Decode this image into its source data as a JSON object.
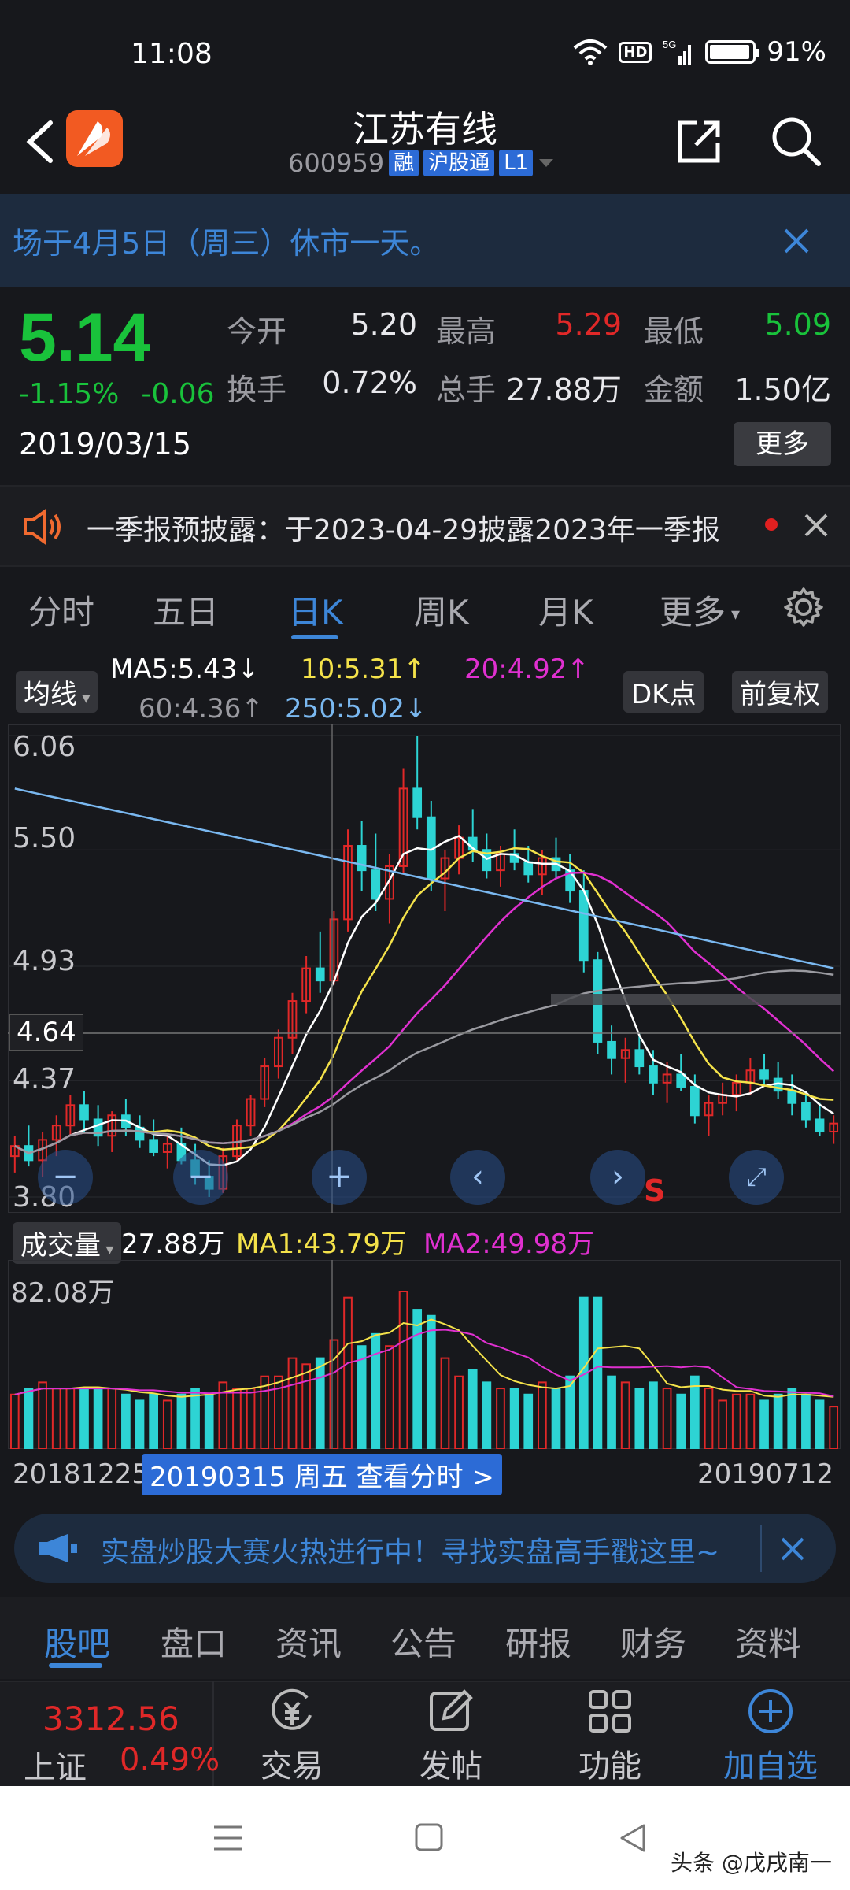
{
  "status": {
    "time": "11:08",
    "hd": "HD",
    "net": "5G",
    "battery": "91%"
  },
  "header": {
    "title": "江苏有线",
    "code": "600959",
    "tags": [
      "融",
      "沪股通",
      "L1"
    ]
  },
  "notice": {
    "text": "场于4月5日（周三）休市一天。"
  },
  "quote": {
    "price": "5.14",
    "change_pct": "-1.15%",
    "change": "-0.06",
    "date": "2019/03/15",
    "cells": [
      {
        "label": "今开",
        "value": "5.20",
        "color": "#e8e8ec"
      },
      {
        "label": "最高",
        "value": "5.29",
        "color": "#e02828"
      },
      {
        "label": "最低",
        "value": "5.09",
        "color": "#19c23b"
      },
      {
        "label": "换手",
        "value": "0.72%",
        "color": "#e8e8ec"
      },
      {
        "label": "总手",
        "value": "27.88万",
        "color": "#e8e8ec"
      },
      {
        "label": "金额",
        "value": "1.50亿",
        "color": "#e8e8ec"
      }
    ],
    "more_label": "更多"
  },
  "announce": {
    "text": "一季报预披露：于2023-04-29披露2023年一季报"
  },
  "chart_tabs": [
    "分时",
    "五日",
    "日K",
    "周K",
    "月K",
    "更多"
  ],
  "ma": {
    "label": "均线",
    "ma5": "MA5:5.43↓",
    "ma10": "10:5.31↑",
    "ma20": "20:4.92↑",
    "ma60": "60:4.36↑",
    "ma250": "250:5.02↓",
    "dk_label": "DK点",
    "adjust_label": "前复权",
    "colors": {
      "ma5": "#ffffff",
      "ma10": "#f4e24a",
      "ma20": "#e030d0",
      "ma60": "#9a9aa0",
      "ma250": "#7ab8f0"
    }
  },
  "kline": {
    "y_labels": [
      "6.06",
      "5.50",
      "4.93",
      "4.37",
      "3.80"
    ],
    "current_price_tag": "4.64",
    "signal": "S"
  },
  "volume": {
    "label": "成交量",
    "value": "27.88万",
    "ma1": "MA1:43.79万",
    "ma2": "MA2:49.98万",
    "max_label": "82.08万"
  },
  "dates": {
    "start": "20181225",
    "cursor": "20190315 周五 查看分时 >",
    "end": "20190712"
  },
  "promo": {
    "text": "实盘炒股大赛火热进行中！寻找实盘高手戳这里~"
  },
  "content_tabs": [
    "股吧",
    "盘口",
    "资讯",
    "公告",
    "研报",
    "财务",
    "资料"
  ],
  "bottom": {
    "index_value": "3312.56",
    "index_name": "上证",
    "index_pct": "0.49%",
    "items": [
      "交易",
      "发帖",
      "功能",
      "加自选"
    ]
  },
  "watermark": "头条 @戊戌南一",
  "chart_data": {
    "type": "candlestick",
    "x_range": [
      "20181225",
      "20190712"
    ],
    "ylim": [
      3.8,
      6.06
    ],
    "y_ticks": [
      6.06,
      5.5,
      4.93,
      4.37,
      3.8
    ],
    "series": [
      {
        "name": "MA5",
        "last": 5.43
      },
      {
        "name": "10",
        "last": 5.31
      },
      {
        "name": "20",
        "last": 4.92
      },
      {
        "name": "60",
        "last": 4.36
      },
      {
        "name": "250",
        "last": 5.02
      }
    ],
    "candles": [
      [
        4.0,
        4.1,
        3.92,
        4.05
      ],
      [
        4.05,
        4.15,
        3.95,
        3.98
      ],
      [
        3.98,
        4.12,
        3.9,
        4.08
      ],
      [
        4.08,
        4.2,
        4.0,
        4.15
      ],
      [
        4.15,
        4.3,
        4.1,
        4.25
      ],
      [
        4.25,
        4.32,
        4.12,
        4.18
      ],
      [
        4.18,
        4.25,
        4.05,
        4.1
      ],
      [
        4.1,
        4.22,
        4.02,
        4.2
      ],
      [
        4.2,
        4.28,
        4.1,
        4.14
      ],
      [
        4.14,
        4.2,
        4.04,
        4.08
      ],
      [
        4.08,
        4.18,
        4.0,
        4.02
      ],
      [
        4.02,
        4.1,
        3.94,
        4.06
      ],
      [
        4.06,
        4.14,
        3.96,
        3.98
      ],
      [
        3.98,
        4.06,
        3.86,
        3.9
      ],
      [
        3.9,
        3.98,
        3.8,
        3.84
      ],
      [
        3.84,
        4.04,
        3.82,
        4.0
      ],
      [
        4.0,
        4.18,
        3.98,
        4.15
      ],
      [
        4.15,
        4.3,
        4.1,
        4.28
      ],
      [
        4.28,
        4.48,
        4.24,
        4.44
      ],
      [
        4.44,
        4.62,
        4.38,
        4.58
      ],
      [
        4.58,
        4.8,
        4.5,
        4.76
      ],
      [
        4.76,
        4.98,
        4.7,
        4.92
      ],
      [
        4.92,
        5.1,
        4.8,
        4.86
      ],
      [
        4.86,
        5.2,
        4.84,
        5.16
      ],
      [
        5.16,
        5.6,
        5.1,
        5.52
      ],
      [
        5.52,
        5.64,
        5.3,
        5.4
      ],
      [
        5.4,
        5.58,
        5.2,
        5.26
      ],
      [
        5.26,
        5.48,
        5.14,
        5.42
      ],
      [
        5.42,
        5.9,
        5.38,
        5.8
      ],
      [
        5.8,
        6.06,
        5.6,
        5.66
      ],
      [
        5.66,
        5.74,
        5.3,
        5.36
      ],
      [
        5.36,
        5.5,
        5.2,
        5.46
      ],
      [
        5.46,
        5.62,
        5.38,
        5.56
      ],
      [
        5.56,
        5.7,
        5.44,
        5.5
      ],
      [
        5.5,
        5.58,
        5.36,
        5.4
      ],
      [
        5.4,
        5.52,
        5.32,
        5.48
      ],
      [
        5.48,
        5.6,
        5.4,
        5.44
      ],
      [
        5.44,
        5.52,
        5.34,
        5.38
      ],
      [
        5.38,
        5.5,
        5.28,
        5.46
      ],
      [
        5.46,
        5.56,
        5.36,
        5.4
      ],
      [
        5.4,
        5.48,
        5.24,
        5.3
      ],
      [
        5.3,
        5.4,
        4.9,
        4.96
      ],
      [
        4.96,
        5.0,
        4.5,
        4.56
      ],
      [
        4.56,
        4.64,
        4.4,
        4.48
      ],
      [
        4.48,
        4.58,
        4.36,
        4.52
      ],
      [
        4.52,
        4.6,
        4.4,
        4.44
      ],
      [
        4.44,
        4.52,
        4.3,
        4.36
      ],
      [
        4.36,
        4.46,
        4.26,
        4.4
      ],
      [
        4.4,
        4.5,
        4.32,
        4.34
      ],
      [
        4.34,
        4.4,
        4.16,
        4.2
      ],
      [
        4.2,
        4.3,
        4.1,
        4.26
      ],
      [
        4.26,
        4.36,
        4.2,
        4.3
      ],
      [
        4.3,
        4.4,
        4.22,
        4.36
      ],
      [
        4.36,
        4.48,
        4.3,
        4.42
      ],
      [
        4.42,
        4.5,
        4.34,
        4.38
      ],
      [
        4.38,
        4.46,
        4.28,
        4.32
      ],
      [
        4.32,
        4.4,
        4.2,
        4.26
      ],
      [
        4.26,
        4.32,
        4.14,
        4.18
      ],
      [
        4.18,
        4.26,
        4.1,
        4.12
      ],
      [
        4.12,
        4.2,
        4.06,
        4.16
      ]
    ]
  }
}
